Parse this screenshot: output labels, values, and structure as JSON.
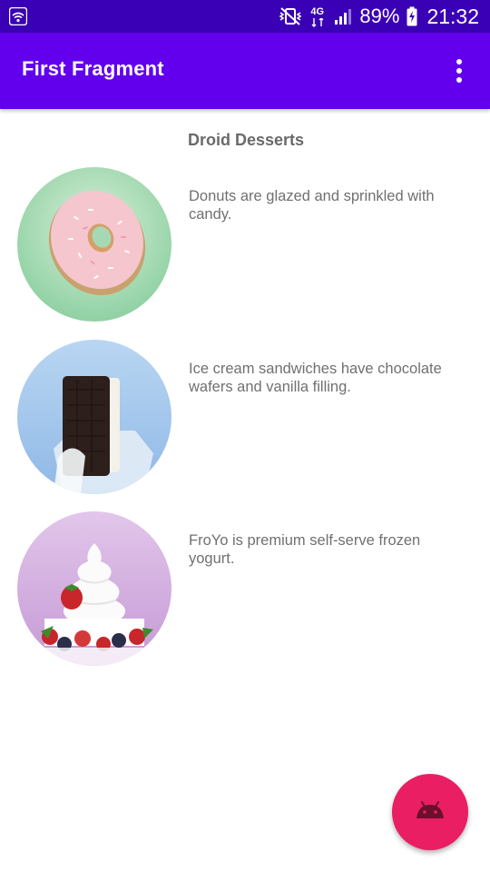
{
  "status_bar": {
    "network_label": "4G",
    "battery": "89%",
    "time": "21:32",
    "icons": [
      "wifi-icon",
      "mute-vibrate-icon",
      "network-4g-icon",
      "signal-icon",
      "battery-charging-icon"
    ]
  },
  "app_bar": {
    "title": "First Fragment",
    "overflow_icon": "more-vertical-icon"
  },
  "content": {
    "header": "Droid Desserts",
    "desserts": [
      {
        "name": "donut",
        "description": "Donuts are glazed and sprinkled with candy."
      },
      {
        "name": "ice-cream-sandwich",
        "description": "Ice cream sandwiches have chocolate wafers and vanilla filling."
      },
      {
        "name": "froyo",
        "description": "FroYo is premium self-serve frozen yogurt."
      }
    ]
  },
  "fab": {
    "icon": "android-icon",
    "color": "#e91e63"
  },
  "colors": {
    "status_bar": "#3a00b5",
    "app_bar": "#6200ee",
    "accent": "#e91e63",
    "text": "#707070"
  }
}
